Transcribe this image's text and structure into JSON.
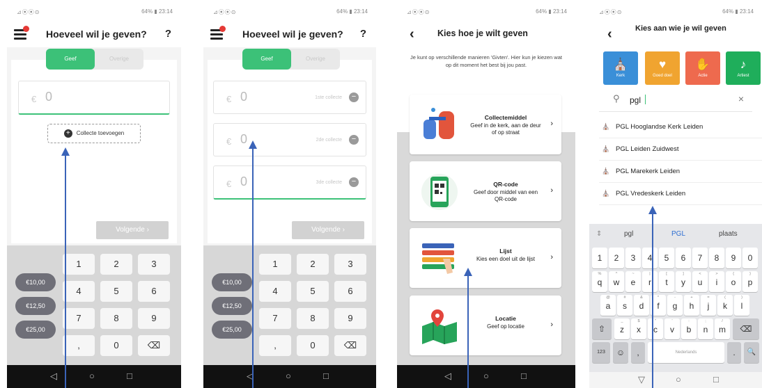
{
  "screen1": {
    "status_left": "⊿⦿⦿⊙",
    "status_right": "64% ▮ 23:14",
    "title": "Hoeveel wil je geven?",
    "help": "?",
    "toggle_give": "Geef",
    "toggle_other": "Overige",
    "currency": "€",
    "amount": "0",
    "add_collection": "Collecte toevoegen",
    "next": "Volgende",
    "chips": [
      "€10,00",
      "€12,50",
      "€25,00"
    ],
    "keys": [
      "1",
      "2",
      "3",
      "4",
      "5",
      "6",
      "7",
      "8",
      "9",
      ",",
      "0",
      "⌫"
    ],
    "nav": [
      "◁",
      "○",
      "□"
    ]
  },
  "screen2": {
    "status_left": "⊿⦿⦿⊙",
    "status_right": "64% ▮ 23:14",
    "title": "Hoeveel wil je geven?",
    "help": "?",
    "toggle_give": "Geef",
    "toggle_other": "Overige",
    "currency": "€",
    "amounts": [
      {
        "value": "0",
        "label": "1ste collecte"
      },
      {
        "value": "0",
        "label": "2de collecte"
      },
      {
        "value": "0",
        "label": "3de collecte"
      }
    ],
    "remove": "−",
    "next": "Volgende",
    "chips": [
      "€10,00",
      "€12,50",
      "€25,00"
    ],
    "keys": [
      "1",
      "2",
      "3",
      "4",
      "5",
      "6",
      "7",
      "8",
      "9",
      ",",
      "0",
      "⌫"
    ],
    "nav": [
      "◁",
      "○",
      "□"
    ]
  },
  "screen3": {
    "status_left": "⊿⦿⦿⊙",
    "status_right": "64% ▮ 23:14",
    "title": "Kies hoe je wilt geven",
    "intro": "Je kunt op verschillende manieren 'Givten'. Hier kun je kiezen wat op dit moment het best bij jou past.",
    "methods": [
      {
        "name": "Collectemiddel",
        "desc": "Geef in de kerk, aan de deur of op straat"
      },
      {
        "name": "QR-code",
        "desc": "Geef door middel van een QR-code"
      },
      {
        "name": "Lijst",
        "desc": "Kies een doel uit de lijst"
      },
      {
        "name": "Locatie",
        "desc": "Geef op locatie"
      }
    ],
    "chevron": "›",
    "nav": [
      "◁",
      "○",
      "□"
    ]
  },
  "screen4": {
    "status_left": "⊿⦿⦿⊙",
    "status_right": "64% ▮ 23:14",
    "title": "Kies aan wie je wil geven",
    "categories": [
      {
        "label": "Kerk",
        "symbol": "⛪",
        "color": "#3a8fd8"
      },
      {
        "label": "Goed doel",
        "symbol": "♥",
        "color": "#f0a430"
      },
      {
        "label": "Actie",
        "symbol": "✋",
        "color": "#ee6a4e"
      },
      {
        "label": "Artiest",
        "symbol": "♪",
        "color": "#1fae5b"
      }
    ],
    "search_value": "pgl",
    "clear": "×",
    "results": [
      "PGL Hooglandse Kerk Leiden",
      "PGL Leiden Zuidwest",
      "PGL Marekerk Leiden",
      "PGL Vredeskerk Leiden"
    ],
    "suggestions": [
      "pgl",
      "PGL",
      "plaats"
    ],
    "keyboard": {
      "numbers": [
        "1",
        "2",
        "3",
        "4",
        "5",
        "6",
        "7",
        "8",
        "9",
        "0"
      ],
      "row1": [
        "q",
        "w",
        "e",
        "r",
        "t",
        "y",
        "u",
        "i",
        "o",
        "p"
      ],
      "row2": [
        "a",
        "s",
        "d",
        "f",
        "g",
        "h",
        "j",
        "k",
        "l"
      ],
      "row3": [
        "z",
        "x",
        "c",
        "v",
        "b",
        "n",
        "m"
      ],
      "row1_hints": [
        "%",
        "^",
        "~",
        "|",
        "[",
        "]",
        "<",
        ">",
        "{",
        "}"
      ],
      "row2_hints": [
        "@",
        "#",
        "&",
        "*",
        "-",
        "+",
        "=",
        "(",
        ")"
      ],
      "row3_hints": [
        "_",
        "$",
        "\"",
        "'",
        ":",
        ";",
        "/"
      ],
      "shift": "⇧",
      "backspace": "⌫",
      "sym": "123",
      "emoji": "☺",
      "comma": ",",
      "space": "Nederlands",
      "period": ".",
      "search": "🔍"
    },
    "nav": [
      "▽",
      "○",
      "□"
    ]
  }
}
